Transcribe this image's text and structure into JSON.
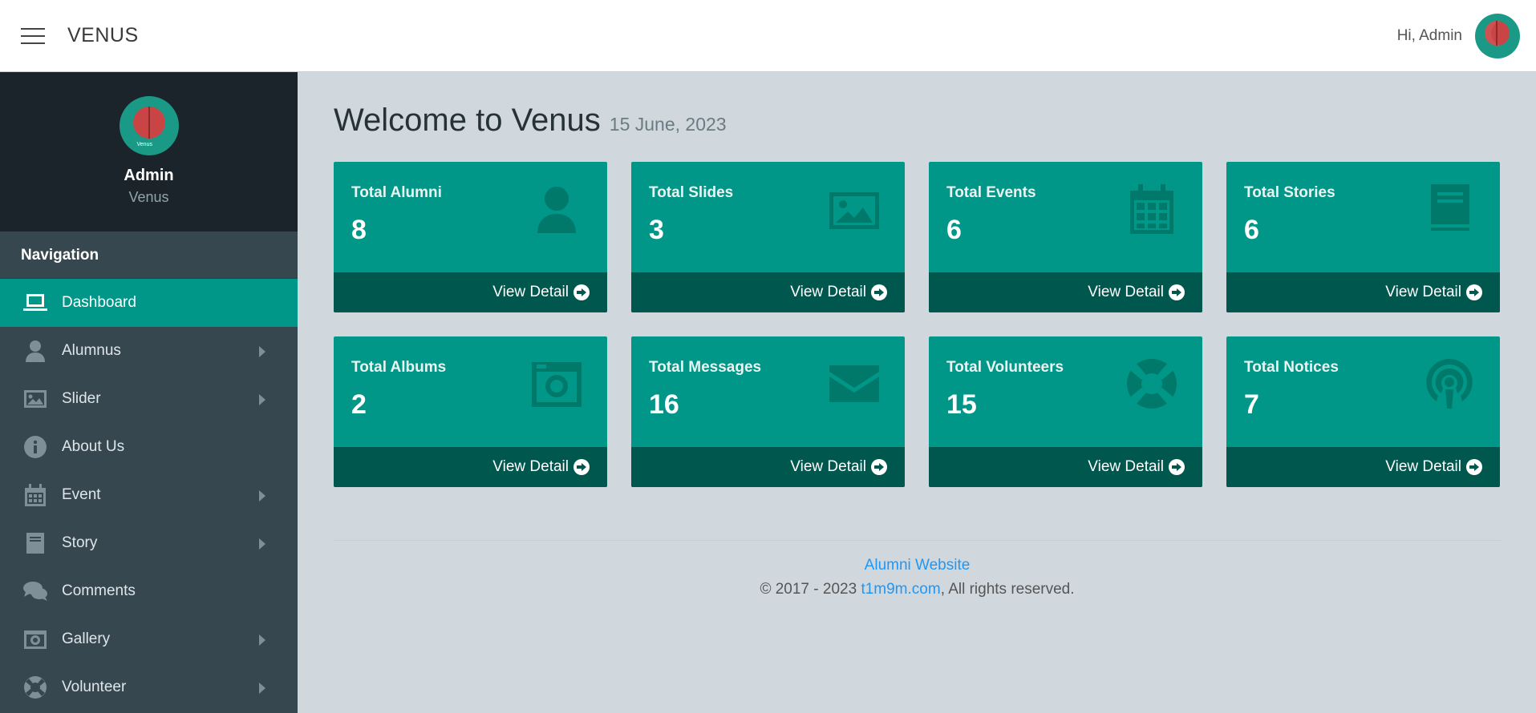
{
  "header": {
    "brand": "VENUS",
    "greeting": "Hi, Admin"
  },
  "sidebar": {
    "profile": {
      "name": "Admin",
      "subtitle": "Venus",
      "avatar_caption": "Venus"
    },
    "nav_title": "Navigation",
    "items": [
      {
        "label": "Dashboard",
        "icon": "laptop-icon",
        "active": true,
        "submenu": false
      },
      {
        "label": "Alumnus",
        "icon": "user-icon",
        "active": false,
        "submenu": true
      },
      {
        "label": "Slider",
        "icon": "image-icon",
        "active": false,
        "submenu": true
      },
      {
        "label": "About Us",
        "icon": "info-icon",
        "active": false,
        "submenu": false
      },
      {
        "label": "Event",
        "icon": "calendar-icon",
        "active": false,
        "submenu": true
      },
      {
        "label": "Story",
        "icon": "book-icon",
        "active": false,
        "submenu": true
      },
      {
        "label": "Comments",
        "icon": "comments-icon",
        "active": false,
        "submenu": false
      },
      {
        "label": "Gallery",
        "icon": "camera-icon",
        "active": false,
        "submenu": true
      },
      {
        "label": "Volunteer",
        "icon": "life-ring-icon",
        "active": false,
        "submenu": true
      }
    ]
  },
  "main": {
    "title": "Welcome to Venus",
    "date": "15 June, 2023",
    "cards": [
      {
        "title": "Total Alumni",
        "value": "8",
        "icon": "user-icon",
        "link": "View Detail"
      },
      {
        "title": "Total Slides",
        "value": "3",
        "icon": "image-icon",
        "link": "View Detail"
      },
      {
        "title": "Total Events",
        "value": "6",
        "icon": "calendar-icon",
        "link": "View Detail"
      },
      {
        "title": "Total Stories",
        "value": "6",
        "icon": "book-icon",
        "link": "View Detail"
      },
      {
        "title": "Total Albums",
        "value": "2",
        "icon": "camera-icon",
        "link": "View Detail"
      },
      {
        "title": "Total Messages",
        "value": "16",
        "icon": "envelope-icon",
        "link": "View Detail"
      },
      {
        "title": "Total Volunteers",
        "value": "15",
        "icon": "life-ring-icon",
        "link": "View Detail"
      },
      {
        "title": "Total Notices",
        "value": "7",
        "icon": "podcast-icon",
        "link": "View Detail"
      }
    ]
  },
  "footer": {
    "site_link": "Alumni Website",
    "copyright_prefix": "© 2017 - 2023 ",
    "domain_link": "t1m9m.com",
    "copyright_suffix": ", All rights reserved."
  },
  "colors": {
    "accent": "#009688",
    "accent_dark": "#00574e",
    "sidebar": "#37474f",
    "sidebar_profile": "#1b242a",
    "background": "#d0d8de",
    "link": "#2196f3"
  }
}
